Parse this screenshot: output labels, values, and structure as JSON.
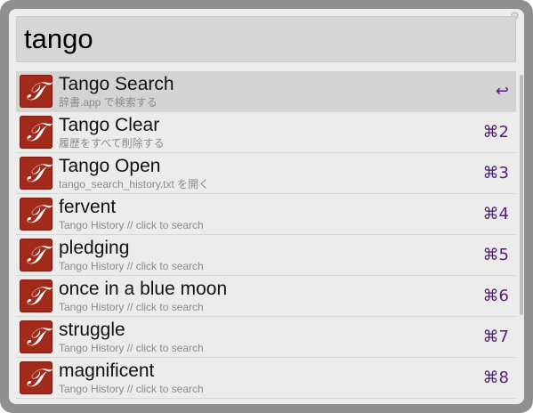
{
  "search": {
    "query": "tango"
  },
  "settings_icon": "gear-icon",
  "results": [
    {
      "title": "Tango Search",
      "subtitle": "辞書.app で検索する",
      "shortcut": "↩",
      "selected": true
    },
    {
      "title": "Tango Clear",
      "subtitle": "履歴をすべて削除する",
      "shortcut": "⌘2"
    },
    {
      "title": "Tango Open",
      "subtitle": "tango_search_history.txt を開く",
      "shortcut": "⌘3"
    },
    {
      "title": "fervent",
      "subtitle": "Tango History // click to search",
      "shortcut": "⌘4"
    },
    {
      "title": "pledging",
      "subtitle": "Tango History // click to search",
      "shortcut": "⌘5"
    },
    {
      "title": "once in a blue moon",
      "subtitle": "Tango History // click to search",
      "shortcut": "⌘6"
    },
    {
      "title": "struggle",
      "subtitle": "Tango History // click to search",
      "shortcut": "⌘7"
    },
    {
      "title": "magnificent",
      "subtitle": "Tango History // click to search",
      "shortcut": "⌘8"
    }
  ],
  "colors": {
    "accent": "#5a1a82",
    "icon_bg": "#a12a1b",
    "selected_row": "#d4d4d4"
  }
}
